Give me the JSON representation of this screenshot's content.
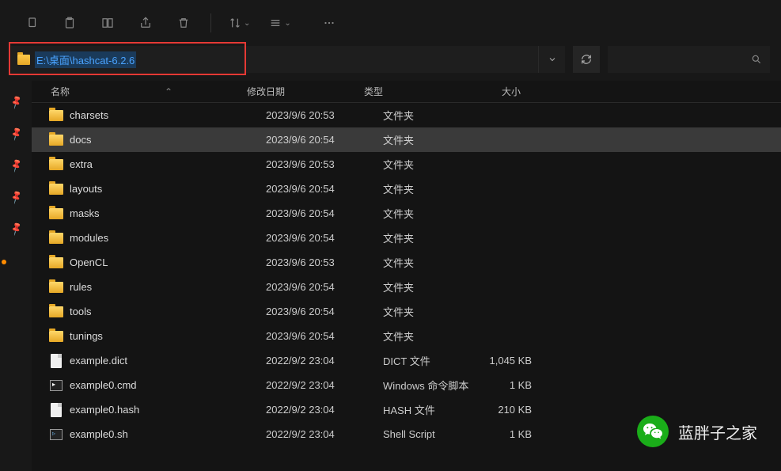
{
  "path": "E:\\桌面\\hashcat-6.2.6",
  "columns": {
    "name": "名称",
    "date": "修改日期",
    "type": "类型",
    "size": "大小"
  },
  "sort_indicator": "⌃",
  "rows": [
    {
      "icon": "folder",
      "name": "charsets",
      "date": "2023/9/6 20:53",
      "type": "文件夹",
      "size": "",
      "selected": false
    },
    {
      "icon": "folder",
      "name": "docs",
      "date": "2023/9/6 20:54",
      "type": "文件夹",
      "size": "",
      "selected": true
    },
    {
      "icon": "folder",
      "name": "extra",
      "date": "2023/9/6 20:53",
      "type": "文件夹",
      "size": "",
      "selected": false
    },
    {
      "icon": "folder",
      "name": "layouts",
      "date": "2023/9/6 20:54",
      "type": "文件夹",
      "size": "",
      "selected": false
    },
    {
      "icon": "folder",
      "name": "masks",
      "date": "2023/9/6 20:54",
      "type": "文件夹",
      "size": "",
      "selected": false
    },
    {
      "icon": "folder",
      "name": "modules",
      "date": "2023/9/6 20:54",
      "type": "文件夹",
      "size": "",
      "selected": false
    },
    {
      "icon": "folder",
      "name": "OpenCL",
      "date": "2023/9/6 20:53",
      "type": "文件夹",
      "size": "",
      "selected": false
    },
    {
      "icon": "folder",
      "name": "rules",
      "date": "2023/9/6 20:54",
      "type": "文件夹",
      "size": "",
      "selected": false
    },
    {
      "icon": "folder",
      "name": "tools",
      "date": "2023/9/6 20:54",
      "type": "文件夹",
      "size": "",
      "selected": false
    },
    {
      "icon": "folder",
      "name": "tunings",
      "date": "2023/9/6 20:54",
      "type": "文件夹",
      "size": "",
      "selected": false
    },
    {
      "icon": "file",
      "name": "example.dict",
      "date": "2022/9/2 23:04",
      "type": "DICT 文件",
      "size": "1,045 KB",
      "selected": false
    },
    {
      "icon": "cmd",
      "name": "example0.cmd",
      "date": "2022/9/2 23:04",
      "type": "Windows 命令脚本",
      "size": "1 KB",
      "selected": false
    },
    {
      "icon": "file",
      "name": "example0.hash",
      "date": "2022/9/2 23:04",
      "type": "HASH 文件",
      "size": "210 KB",
      "selected": false
    },
    {
      "icon": "sh",
      "name": "example0.sh",
      "date": "2022/9/2 23:04",
      "type": "Shell Script",
      "size": "1 KB",
      "selected": false
    }
  ],
  "watermark": "蓝胖子之家"
}
